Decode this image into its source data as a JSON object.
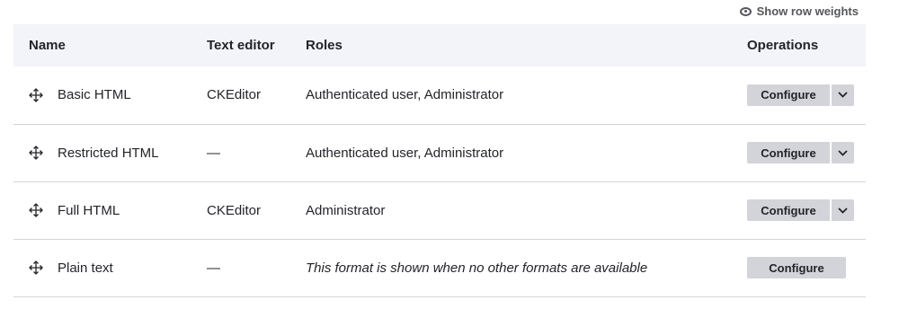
{
  "toolbar": {
    "show_row_weights_label": "Show row weights"
  },
  "table": {
    "headers": {
      "name": "Name",
      "text_editor": "Text editor",
      "roles": "Roles",
      "operations": "Operations"
    },
    "rows": [
      {
        "name": "Basic HTML",
        "text_editor": "CKEditor",
        "roles": "Authenticated user, Administrator",
        "configure_label": "Configure"
      },
      {
        "name": "Restricted HTML",
        "text_editor": "—",
        "roles": "Authenticated user, Administrator",
        "configure_label": "Configure"
      },
      {
        "name": "Full HTML",
        "text_editor": "CKEditor",
        "roles": "Administrator",
        "configure_label": "Configure"
      },
      {
        "name": "Plain text",
        "text_editor": "—",
        "roles": "This format is shown when no other formats are available",
        "configure_label": "Configure"
      }
    ]
  },
  "icons": {
    "drag": "drag-handle-icon",
    "eye": "eye-icon",
    "dropdown": "chevron-down-icon"
  },
  "colors": {
    "header_bg": "#f3f4f9",
    "button_bg": "#d3d4d9",
    "row_border": "#d3d4d9",
    "text": "#232429"
  }
}
